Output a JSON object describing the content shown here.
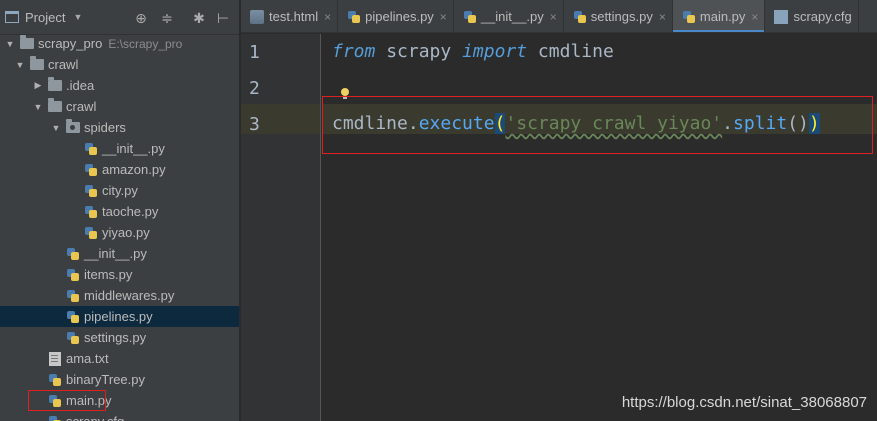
{
  "project_panel": {
    "title": "Project",
    "tree": [
      {
        "label": "scrapy_pro",
        "path": "E:\\scrapy_pro",
        "icon": "folder-icon",
        "expanded": true,
        "level": 0
      },
      {
        "label": "crawl",
        "icon": "folder-icon",
        "expanded": true,
        "level": 1
      },
      {
        "label": ".idea",
        "icon": "folder-icon",
        "expanded": false,
        "level": 2
      },
      {
        "label": "crawl",
        "icon": "folder-icon",
        "expanded": true,
        "level": 2
      },
      {
        "label": "spiders",
        "icon": "package-folder-icon",
        "expanded": true,
        "level": 3
      },
      {
        "label": "__init__.py",
        "icon": "python-file-icon",
        "level": 4
      },
      {
        "label": "amazon.py",
        "icon": "python-file-icon",
        "level": 4
      },
      {
        "label": "city.py",
        "icon": "python-file-icon",
        "level": 4
      },
      {
        "label": "taoche.py",
        "icon": "python-file-icon",
        "level": 4
      },
      {
        "label": "yiyao.py",
        "icon": "python-file-icon",
        "level": 4
      },
      {
        "label": "__init__.py",
        "icon": "python-file-icon",
        "level": 3
      },
      {
        "label": "items.py",
        "icon": "python-file-icon",
        "level": 3
      },
      {
        "label": "middlewares.py",
        "icon": "python-file-icon",
        "level": 3
      },
      {
        "label": "pipelines.py",
        "icon": "python-file-icon",
        "level": 3,
        "selected": true
      },
      {
        "label": "settings.py",
        "icon": "python-file-icon",
        "level": 3
      },
      {
        "label": "ama.txt",
        "icon": "text-file-icon",
        "level": 2
      },
      {
        "label": "binaryTree.py",
        "icon": "python-file-icon",
        "level": 2
      },
      {
        "label": "main.py",
        "icon": "python-file-icon",
        "level": 2,
        "highlighted": true
      },
      {
        "label": "scrapy.cfg",
        "icon": "config-file-icon",
        "level": 2
      }
    ]
  },
  "tabs": [
    {
      "label": "test.html",
      "icon": "html-file-icon"
    },
    {
      "label": "pipelines.py",
      "icon": "python-file-icon"
    },
    {
      "label": "__init__.py",
      "icon": "python-file-icon"
    },
    {
      "label": "settings.py",
      "icon": "python-file-icon"
    },
    {
      "label": "main.py",
      "icon": "python-file-icon",
      "active": true
    },
    {
      "label": "scrapy.cfg",
      "icon": "config-file-icon"
    }
  ],
  "editor": {
    "line_numbers": [
      "1",
      "2",
      "3"
    ],
    "line1": {
      "kw_from": "from",
      "module": " scrapy ",
      "kw_import": "import",
      "name": " cmdline"
    },
    "line3": {
      "obj": "cmdline.",
      "method": "execute",
      "open": "(",
      "str": "'scrapy crawl yiyao'",
      "dot": ".",
      "method2": "split",
      "parens": "()",
      "close": ")"
    }
  },
  "watermark": "https://blog.csdn.net/sinat_38068807",
  "colors": {
    "accent": "#4a88c7",
    "highlight_box": "#e02020",
    "selection": "#0d293e"
  }
}
